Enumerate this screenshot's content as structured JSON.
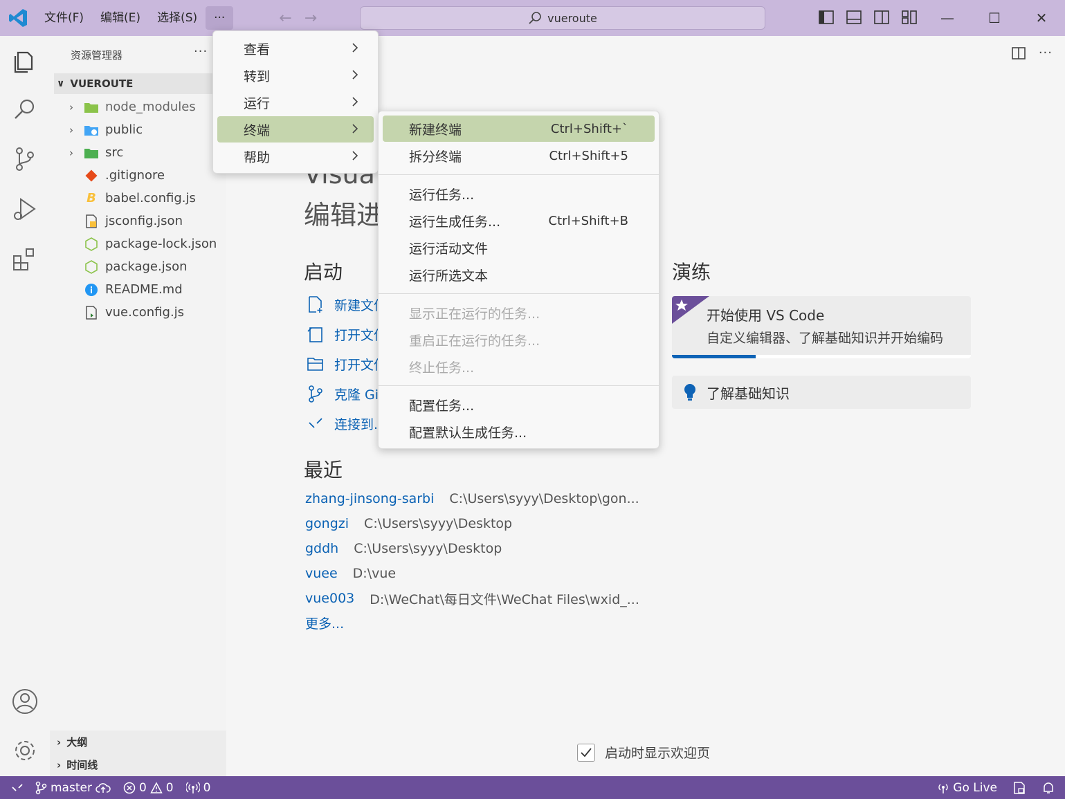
{
  "titlebar": {
    "menus": [
      "文件(F)",
      "编辑(E)",
      "选择(S)",
      "···"
    ],
    "search_text": "vueroute"
  },
  "sidebar": {
    "title": "资源管理器",
    "more": "···",
    "folder": "VUEROUTE",
    "items": [
      {
        "name": "node_modules",
        "kind": "folder"
      },
      {
        "name": "public",
        "kind": "folder"
      },
      {
        "name": "src",
        "kind": "folder"
      },
      {
        "name": ".gitignore",
        "kind": "file"
      },
      {
        "name": "babel.config.js",
        "kind": "file"
      },
      {
        "name": "jsconfig.json",
        "kind": "file"
      },
      {
        "name": "package-lock.json",
        "kind": "file"
      },
      {
        "name": "package.json",
        "kind": "file"
      },
      {
        "name": "README.md",
        "kind": "file"
      },
      {
        "name": "vue.config.js",
        "kind": "file"
      }
    ],
    "outline": "大纲",
    "timeline": "时间线"
  },
  "more_menu": {
    "items": [
      "查看",
      "转到",
      "运行",
      "终端",
      "帮助"
    ],
    "highlighted": "终端"
  },
  "terminal_menu": {
    "new_terminal": {
      "label": "新建终端",
      "shortcut": "Ctrl+Shift+`"
    },
    "split_terminal": {
      "label": "拆分终端",
      "shortcut": "Ctrl+Shift+5"
    },
    "run_task": {
      "label": "运行任务..."
    },
    "run_build_task": {
      "label": "运行生成任务...",
      "shortcut": "Ctrl+Shift+B"
    },
    "run_active_file": {
      "label": "运行活动文件"
    },
    "run_selected_text": {
      "label": "运行所选文本"
    },
    "show_running_tasks": {
      "label": "显示正在运行的任务..."
    },
    "restart_running_task": {
      "label": "重启正在运行的任务..."
    },
    "terminate_task": {
      "label": "终止任务..."
    },
    "configure_tasks": {
      "label": "配置任务..."
    },
    "configure_default_build_task": {
      "label": "配置默认生成任务..."
    }
  },
  "welcome": {
    "title_partial": "Visua",
    "subtitle_partial": "编辑进",
    "start_heading": "启动",
    "start_items": [
      "新建文件",
      "打开文件",
      "打开文件夹",
      "克隆 Git",
      "连接到..."
    ],
    "recent_heading": "最近",
    "recent": [
      {
        "name": "zhang-jinsong-sarbi",
        "path": "C:\\Users\\syyy\\Desktop\\gon..."
      },
      {
        "name": "gongzi",
        "path": "C:\\Users\\syyy\\Desktop"
      },
      {
        "name": "gddh",
        "path": "C:\\Users\\syyy\\Desktop"
      },
      {
        "name": "vuee",
        "path": "D:\\vue"
      },
      {
        "name": "vue003",
        "path": "D:\\WeChat\\每日文件\\WeChat Files\\wxid_..."
      }
    ],
    "more": "更多...",
    "walkthrough_heading": "演练",
    "walkthrough_title": "开始使用 VS Code",
    "walkthrough_desc": "自定义编辑器、了解基础知识并开始编码",
    "walkthrough_progress": 0.28,
    "learn_title": "了解基础知识",
    "show_on_startup": "启动时显示欢迎页"
  },
  "statusbar": {
    "branch": "master",
    "errors": "0",
    "warnings": "0",
    "ports": "0",
    "go_live": "Go Live"
  },
  "colors": {
    "titlebar": "#c9b8dc",
    "statusbar": "#6b4f9a",
    "menu_highlight": "#c5d5ad",
    "link": "#0b62b4"
  }
}
